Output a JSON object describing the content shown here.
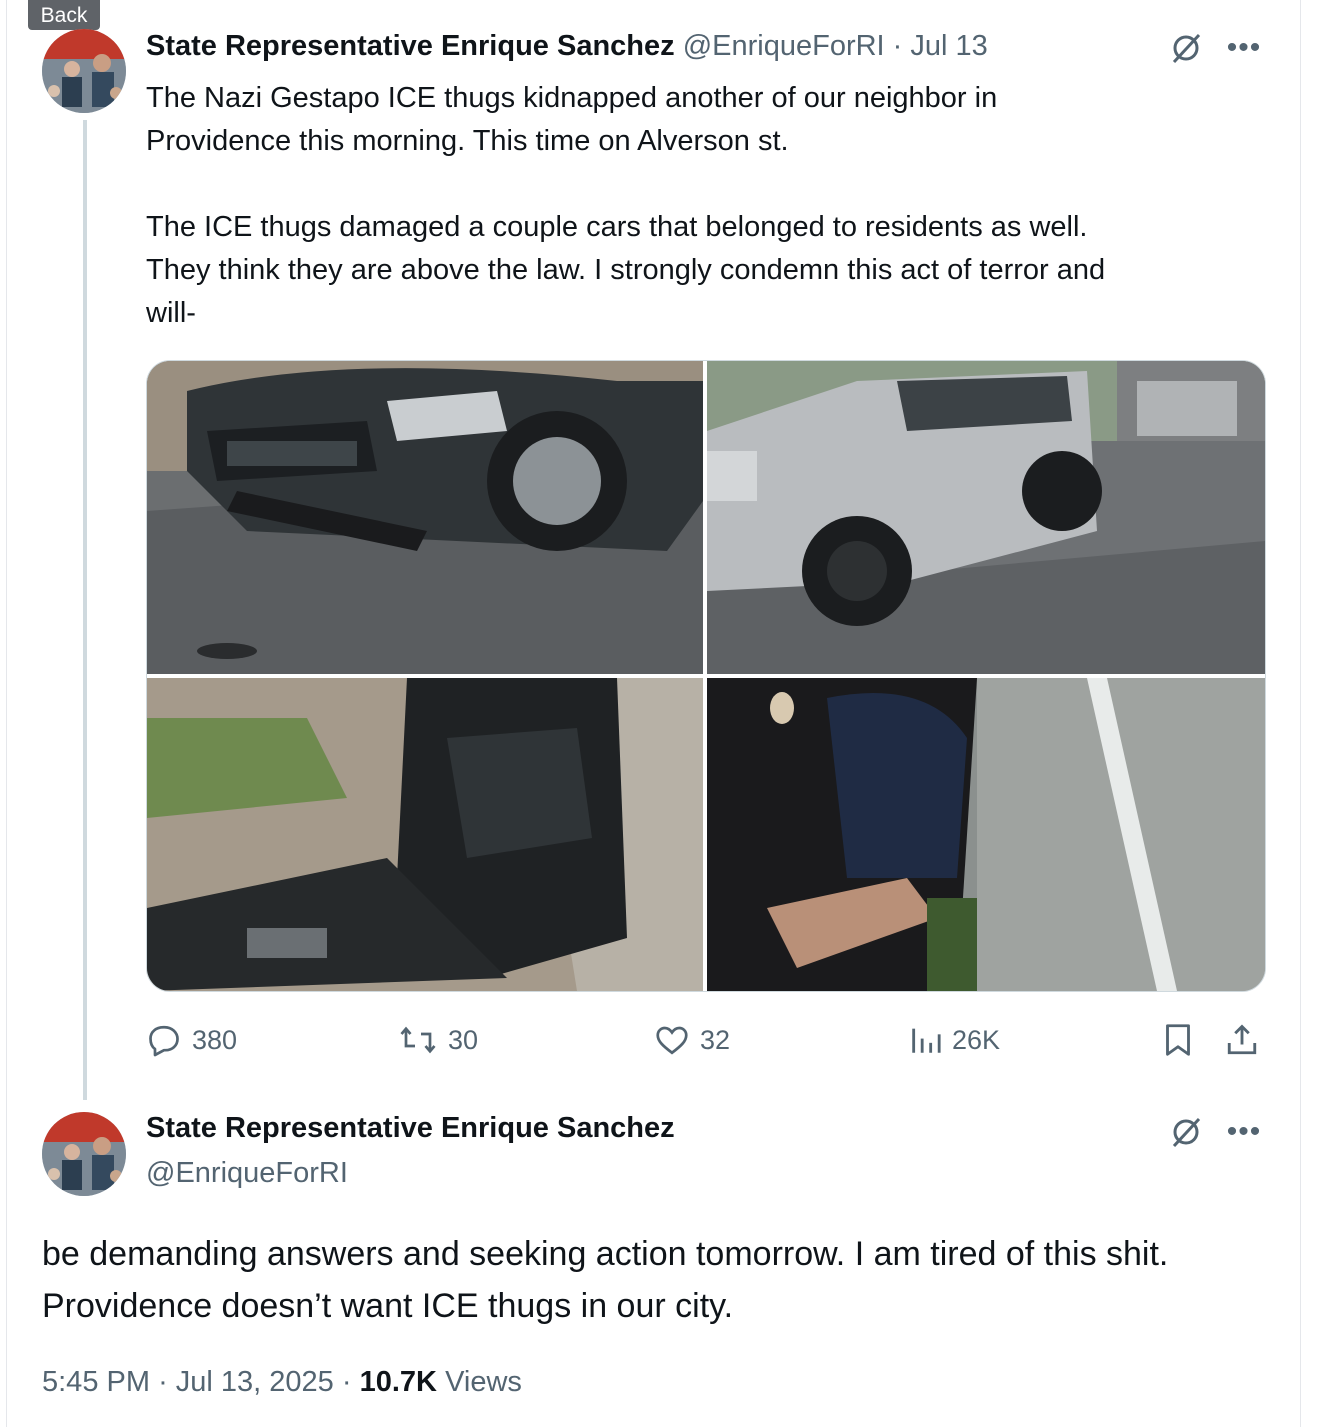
{
  "back_label": "Back",
  "tweet": {
    "author_name": "State Representative Enrique Sanchez",
    "handle": "@EnriqueForRI",
    "separator": "·",
    "date": "Jul 13",
    "text": "The Nazi Gestapo ICE thugs kidnapped another of our neighbor in\nProvidence this morning. This time on Alverson st.\n\nThe ICE thugs damaged a couple cars that belonged to residents as well.\nThey think they are above the law. I strongly condemn this act of terror and\nwill-",
    "metrics": {
      "replies": "380",
      "reposts": "30",
      "likes": "32",
      "views": "26K"
    }
  },
  "reply": {
    "author_name": "State Representative Enrique Sanchez",
    "handle": "@EnriqueForRI",
    "text": "be demanding answers and seeking action tomorrow. I am tired of this shit. Providence doesn’t want ICE thugs in our city.",
    "time": "5:45 PM",
    "separator": "·",
    "date": "Jul 13, 2025",
    "views_count": "10.7K",
    "views_label": "Views"
  },
  "colors": {
    "muted": "#536471",
    "text": "#0f1419",
    "border": "#cfd9de"
  },
  "icons": [
    "grok-icon",
    "more-icon",
    "reply-icon",
    "repost-icon",
    "like-icon",
    "views-icon",
    "bookmark-icon",
    "share-icon"
  ]
}
